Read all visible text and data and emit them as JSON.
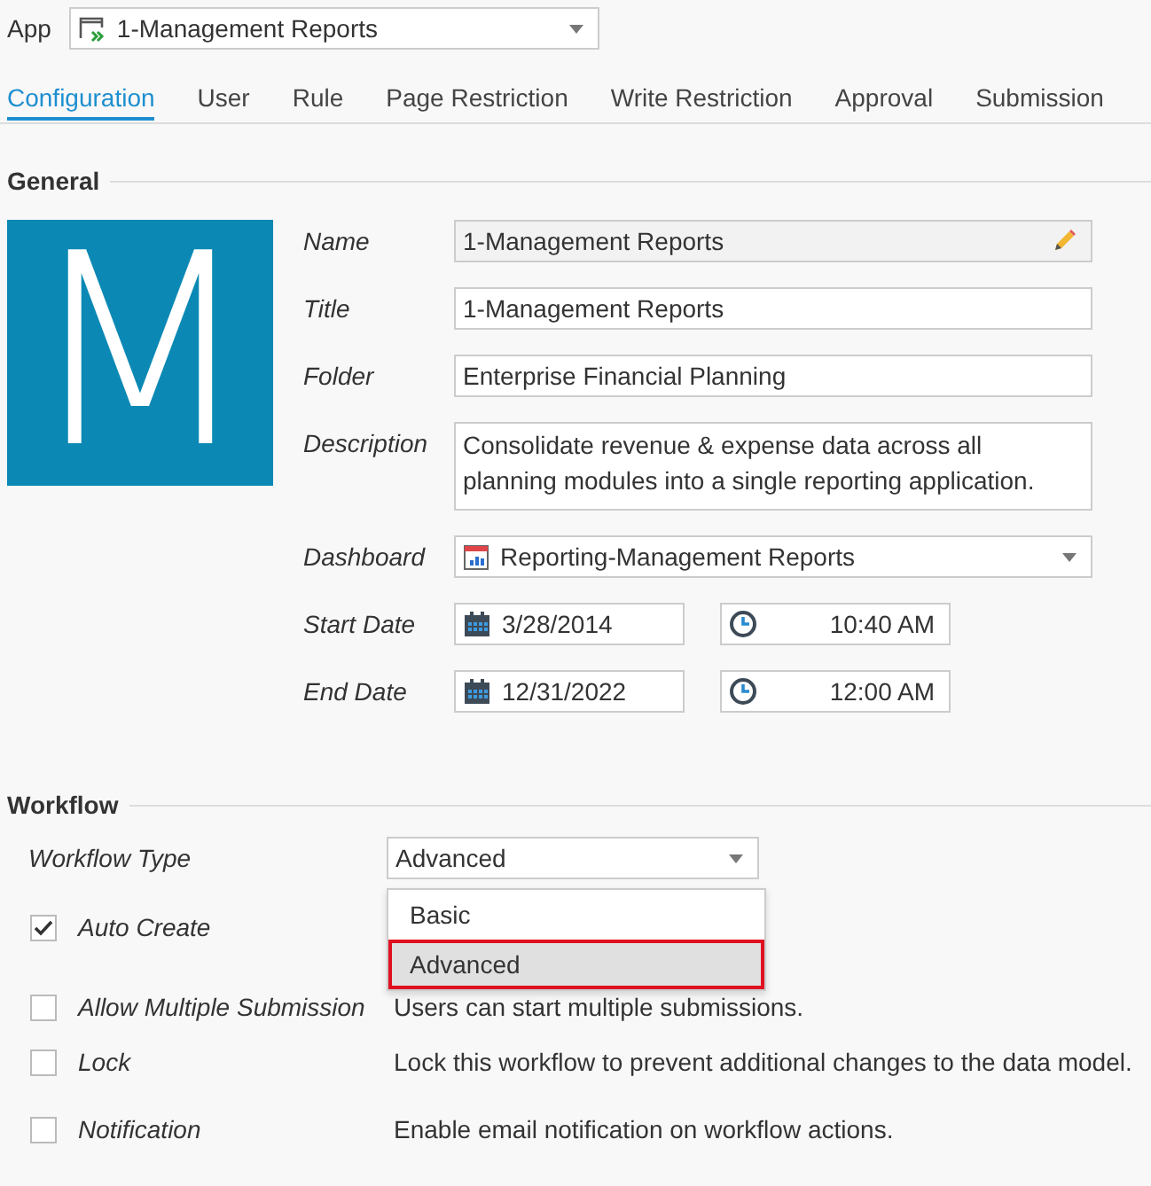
{
  "app": {
    "label": "App",
    "value": "1-Management Reports"
  },
  "tabs": [
    {
      "label": "Configuration",
      "selected": true
    },
    {
      "label": "User",
      "selected": false
    },
    {
      "label": "Rule",
      "selected": false
    },
    {
      "label": "Page Restriction",
      "selected": false
    },
    {
      "label": "Write Restriction",
      "selected": false
    },
    {
      "label": "Approval",
      "selected": false
    },
    {
      "label": "Submission",
      "selected": false
    }
  ],
  "general": {
    "title": "General",
    "logo_letter": "M",
    "fields": [
      {
        "kind": "readonly",
        "label": "Name",
        "value": "1-Management Reports"
      },
      {
        "kind": "text",
        "label": "Title",
        "value": "1-Management Reports"
      },
      {
        "kind": "text",
        "label": "Folder",
        "value": "Enterprise Financial Planning"
      },
      {
        "kind": "textarea",
        "label": "Description",
        "value": "Consolidate revenue & expense data across all planning modules into a single reporting application."
      },
      {
        "kind": "select",
        "label": "Dashboard",
        "value": "Reporting-Management Reports"
      },
      {
        "kind": "datetime",
        "label": "Start Date",
        "date": "3/28/2014",
        "time": "10:40 AM"
      },
      {
        "kind": "datetime",
        "label": "End Date",
        "date": "12/31/2022",
        "time": "12:00 AM"
      }
    ]
  },
  "workflow": {
    "title": "Workflow",
    "type_label": "Workflow Type",
    "type_value": "Advanced",
    "type_options": [
      {
        "label": "Basic",
        "selected": false
      },
      {
        "label": "Advanced",
        "selected": true
      }
    ],
    "options": [
      {
        "label": "Auto Create",
        "checked": true
      },
      {
        "label": "Allow Multiple Submission",
        "checked": false,
        "description": "Users can start multiple submissions."
      },
      {
        "label": "Lock",
        "checked": false,
        "description": "Lock this workflow to prevent additional changes to the data model."
      },
      {
        "label": "Notification",
        "checked": false,
        "description": "Enable email notification on workflow actions."
      }
    ]
  }
}
